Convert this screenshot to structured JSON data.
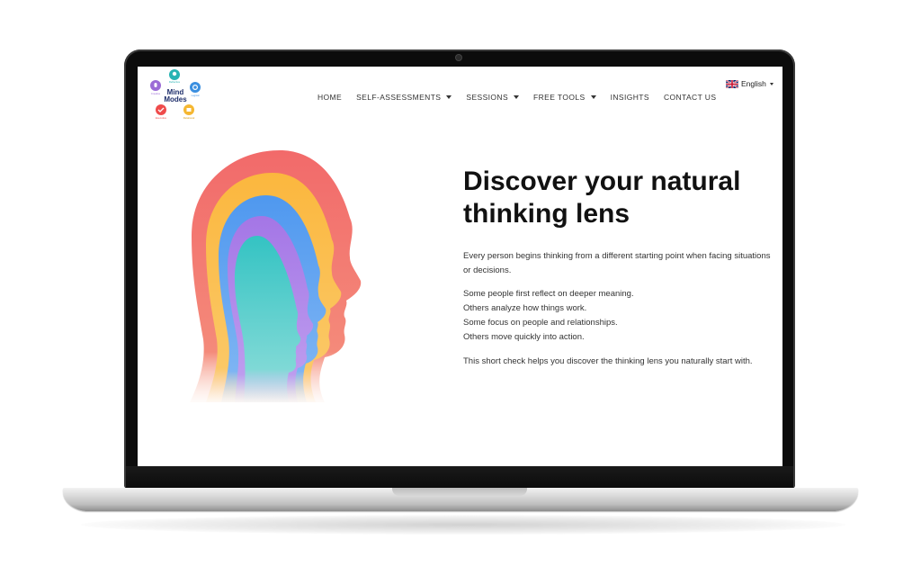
{
  "brand": {
    "name": "Mind Modes",
    "logo_text_line1": "Mind",
    "logo_text_line2": "Modes",
    "colors": {
      "purple": "#9b6bd6",
      "teal": "#27b3b3",
      "blue": "#3a8fe0",
      "red": "#ef4b4b",
      "yellow": "#f5b731",
      "navy": "#1f2f6b"
    }
  },
  "nav": {
    "items": [
      {
        "label": "HOME",
        "has_dropdown": false
      },
      {
        "label": "SELF-ASSESSMENTS",
        "has_dropdown": true
      },
      {
        "label": "SESSIONS",
        "has_dropdown": true
      },
      {
        "label": "FREE TOOLS",
        "has_dropdown": true
      },
      {
        "label": "INSIGHTS",
        "has_dropdown": false
      },
      {
        "label": "CONTACT US",
        "has_dropdown": false
      }
    ]
  },
  "language": {
    "label": "English",
    "flag_icon": "uk-flag-icon"
  },
  "hero": {
    "headline_line1": "Discover your natural",
    "headline_line2": "thinking lens",
    "intro": "Every person begins thinking from a different starting point when facing situations or decisions.",
    "list": [
      "Some people first reflect on deeper meaning.",
      "Others analyze how things work.",
      "Some focus on people and relationships.",
      "Others move quickly into action."
    ],
    "closing": "This short check helps you discover the thinking lens you naturally start with.",
    "illustration_icon": "layered-heads-illustration",
    "illustration_colors": [
      "#f26a6a",
      "#fbc04a",
      "#5b9ff0",
      "#a77be6",
      "#3ec9c4"
    ]
  }
}
